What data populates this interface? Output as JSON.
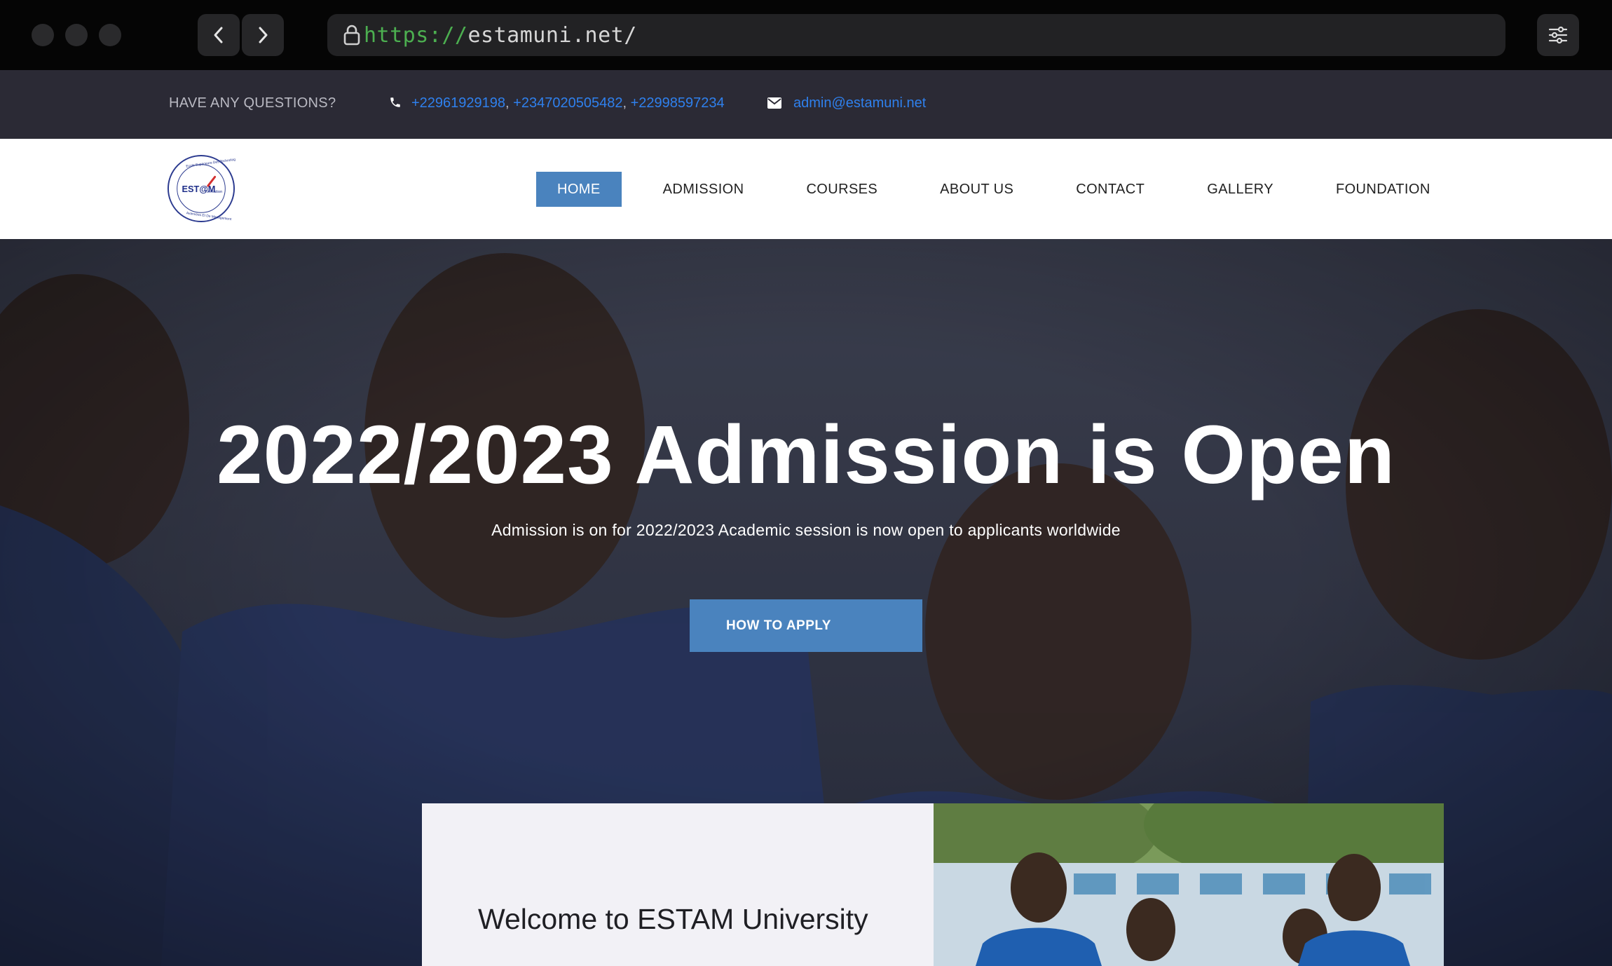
{
  "browser": {
    "url_scheme": "https://",
    "url_host": "estamuni.net/"
  },
  "topbar": {
    "question": "HAVE ANY QUESTIONS?",
    "phones": [
      "+22961929198",
      "+2347020505482",
      "+22998597234"
    ],
    "separator": ", ",
    "email": "admin@estamuni.net"
  },
  "logo": {
    "text": "EST@M",
    "sub": "formation",
    "ring_top": "Ecole Supérieure Des Technologies",
    "ring_bottom": "Avancées Et De Management"
  },
  "nav": {
    "items": [
      "HOME",
      "ADMISSION",
      "COURSES",
      "ABOUT US",
      "CONTACT",
      "GALLERY",
      "FOUNDATION"
    ],
    "active": "HOME"
  },
  "hero": {
    "title": "2022/2023 Admission is Open",
    "subtitle": "Admission is on for 2022/2023 Academic session is now open to applicants worldwide",
    "button": "HOW TO APPLY"
  },
  "welcome": {
    "heading": "Welcome to ESTAM University"
  },
  "colors": {
    "accent": "#4a83be",
    "link": "#2f80ed",
    "infobar_bg": "#2b2a35"
  }
}
